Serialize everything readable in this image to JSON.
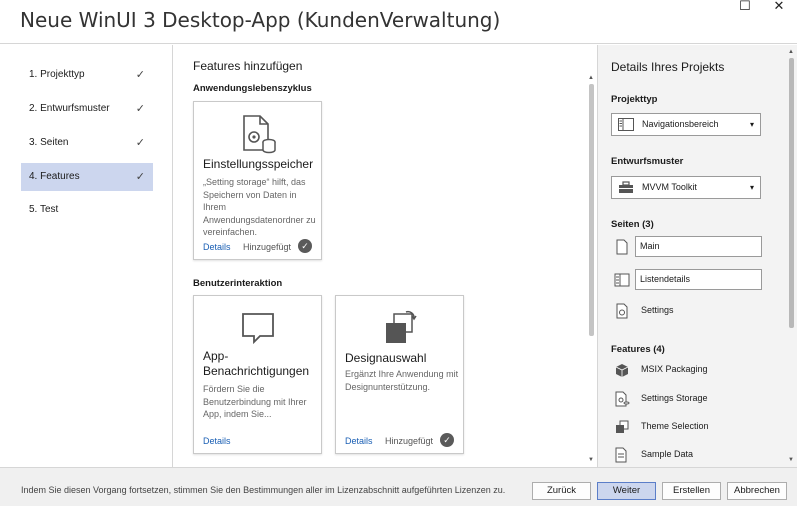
{
  "window": {
    "title": "Neue WinUI 3 Desktop-App (KundenVerwaltung)",
    "maximize_glyph": "☐",
    "close_glyph": "✕"
  },
  "steps": [
    {
      "label": "1. Projekttyp",
      "check": "✓"
    },
    {
      "label": "2. Entwurfsmuster",
      "check": "✓"
    },
    {
      "label": "3. Seiten",
      "check": "✓"
    },
    {
      "label": "4. Features",
      "check": "✓"
    },
    {
      "label": "5. Test",
      "check": ""
    }
  ],
  "main": {
    "heading": "Features hinzufügen",
    "sections": [
      {
        "title": "Anwendungslebenszyklus",
        "cards": [
          {
            "title": "Einstellungsspeicher",
            "description": "„Setting storage“ hilft, das Speichern von Daten in Ihrem Anwendungsdatenordner zu vereinfachen.",
            "details": "Details",
            "added": "Hinzugefügt",
            "badge": "✓",
            "icon": "settings-storage-icon"
          }
        ]
      },
      {
        "title": "Benutzerinteraktion",
        "cards": [
          {
            "title": "App-Benachrichtigungen",
            "description": "Fördern Sie die Benutzerbindung mit Ihrer App, indem Sie...",
            "details": "Details",
            "added": "",
            "badge": "",
            "icon": "notification-icon"
          },
          {
            "title": "Designauswahl",
            "description": "Ergänzt Ihre Anwendung mit Designunterstützung.",
            "details": "Details",
            "added": "Hinzugefügt",
            "badge": "✓",
            "icon": "theme-selection-icon"
          }
        ]
      }
    ]
  },
  "details": {
    "heading": "Details Ihres Projekts",
    "project_type": {
      "label": "Projekttyp",
      "value": "Navigationsbereich",
      "arrow": "▾"
    },
    "design_pattern": {
      "label": "Entwurfsmuster",
      "value": "MVVM Toolkit",
      "arrow": "▾"
    },
    "pages": {
      "label": "Seiten (3)",
      "items": [
        "Main",
        "Listendetails",
        "Settings"
      ]
    },
    "features": {
      "label": "Features (4)",
      "items": [
        "MSIX Packaging",
        "Settings Storage",
        "Theme Selection",
        "Sample Data"
      ]
    }
  },
  "footer": {
    "legal": "Indem Sie diesen Vorgang fortsetzen, stimmen Sie den Bestimmungen aller im Lizenzabschnitt aufgeführten Lizenzen zu.",
    "back": "Zurück",
    "next": "Weiter",
    "create": "Erstellen",
    "cancel": "Abbrechen"
  },
  "scroll": {
    "up": "▲",
    "down": "▼"
  },
  "colors": {
    "accent": "#ccd6ee",
    "link": "#1a5fb4",
    "panel": "#f3f3f3"
  }
}
